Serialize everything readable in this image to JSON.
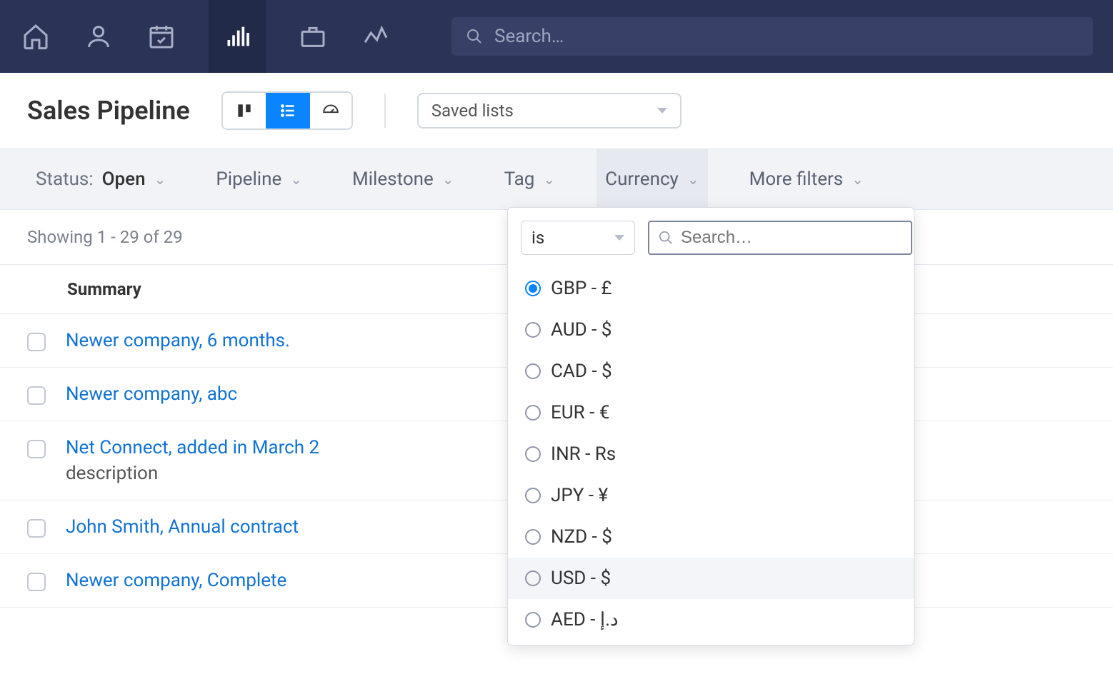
{
  "search": {
    "placeholder": "Search…"
  },
  "page": {
    "title": "Sales Pipeline"
  },
  "saved_lists": {
    "label": "Saved lists"
  },
  "filters": {
    "status": {
      "label": "Status:",
      "value": "Open"
    },
    "pipeline": {
      "label": "Pipeline"
    },
    "milestone": {
      "label": "Milestone"
    },
    "tag": {
      "label": "Tag"
    },
    "currency": {
      "label": "Currency"
    },
    "more": {
      "label": "More filters"
    }
  },
  "showing": "Showing 1 - 29 of 29",
  "table": {
    "header": "Summary",
    "rows": [
      {
        "title": "Newer company, 6 months.",
        "desc": ""
      },
      {
        "title": "Newer company, abc",
        "desc": ""
      },
      {
        "title": "Net Connect, added in March 2",
        "desc": "description"
      },
      {
        "title": "John Smith, Annual contract",
        "desc": ""
      },
      {
        "title": "Newer company, Complete",
        "desc": ""
      }
    ]
  },
  "dropdown": {
    "operator": "is",
    "search_placeholder": "Search…",
    "selected": "GBP - £",
    "hovered": "USD - $",
    "options": [
      "GBP - £",
      "AUD - $",
      "CAD - $",
      "EUR - €",
      "INR - Rs",
      "JPY - ¥",
      "NZD - $",
      "USD - $",
      "AED - د.إ"
    ]
  }
}
